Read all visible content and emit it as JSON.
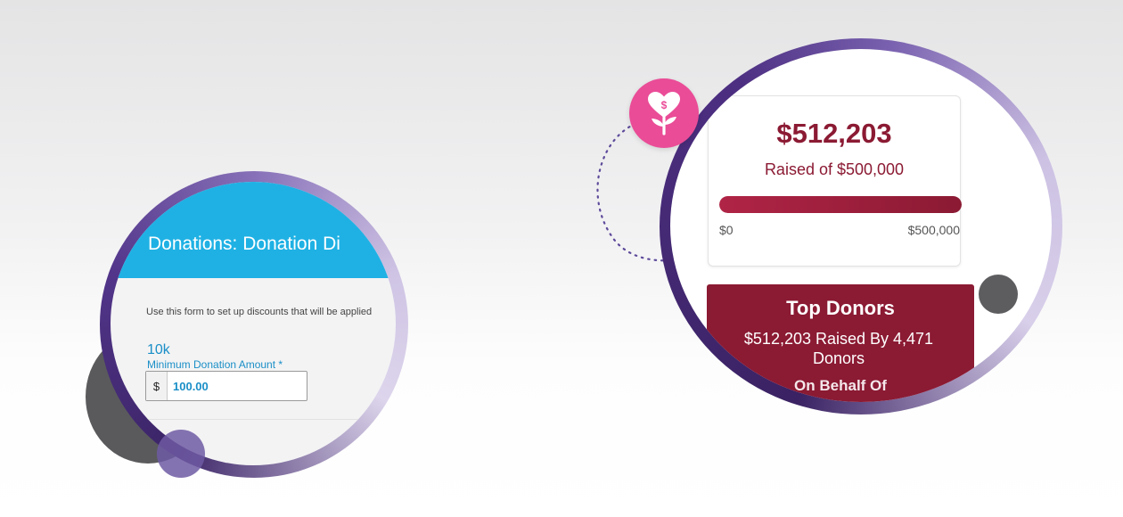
{
  "discount_form": {
    "title": "Donations: Donation Di",
    "description": "Use this form to set up discounts that will be applied",
    "field_value": "10k",
    "field_label": "Minimum Donation Amount *",
    "currency_symbol": "$",
    "amount": "100.00",
    "header_color": "#1fb1e4",
    "accent_color": "#1a8fc7"
  },
  "campaign": {
    "raised": "$512,203",
    "raised_of": "Raised of $500,000",
    "progress_fraction": 1.0,
    "scale_min": "$0",
    "scale_max": "$500,000",
    "brand_color": "#8b1a33"
  },
  "top_donors": {
    "title": "Top Donors",
    "summary": "$512,203 Raised By 4,471 Donors",
    "partial_line": "On Behalf Of"
  },
  "badge": {
    "icon": "heart-dollar-sprout-icon",
    "color": "#ea4c97"
  }
}
